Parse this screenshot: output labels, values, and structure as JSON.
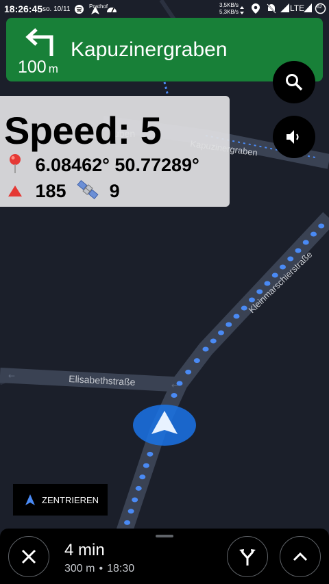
{
  "status_bar": {
    "time": "18:26:45",
    "date": "so. 10/11",
    "notification_text": "Posthof",
    "net_up": "3,5KB/s",
    "net_down": "5,3KB/s",
    "network": "LTE",
    "battery": "62"
  },
  "nav_banner": {
    "distance_value": "100",
    "distance_unit": "m",
    "street": "Kapuzinergraben",
    "background_color": "#188038",
    "icon": "turn-left-icon"
  },
  "map": {
    "street_labels": [
      "Kapuzinergraben",
      "Kleinmarschierstraße",
      "Elisabethstraße",
      "uben"
    ],
    "route_color": "#4a8af4",
    "position_marker_color": "#1a73e8"
  },
  "overlay": {
    "speed_label": "Speed: 5",
    "coordinates": "6.08462° 50.77289°",
    "altitude": "185",
    "satellites": "9"
  },
  "recenter": {
    "label": "ZENTRIEREN"
  },
  "bottom_sheet": {
    "eta_time": "4 min",
    "distance": "300 m",
    "separator": "•",
    "arrival": "18:30"
  }
}
